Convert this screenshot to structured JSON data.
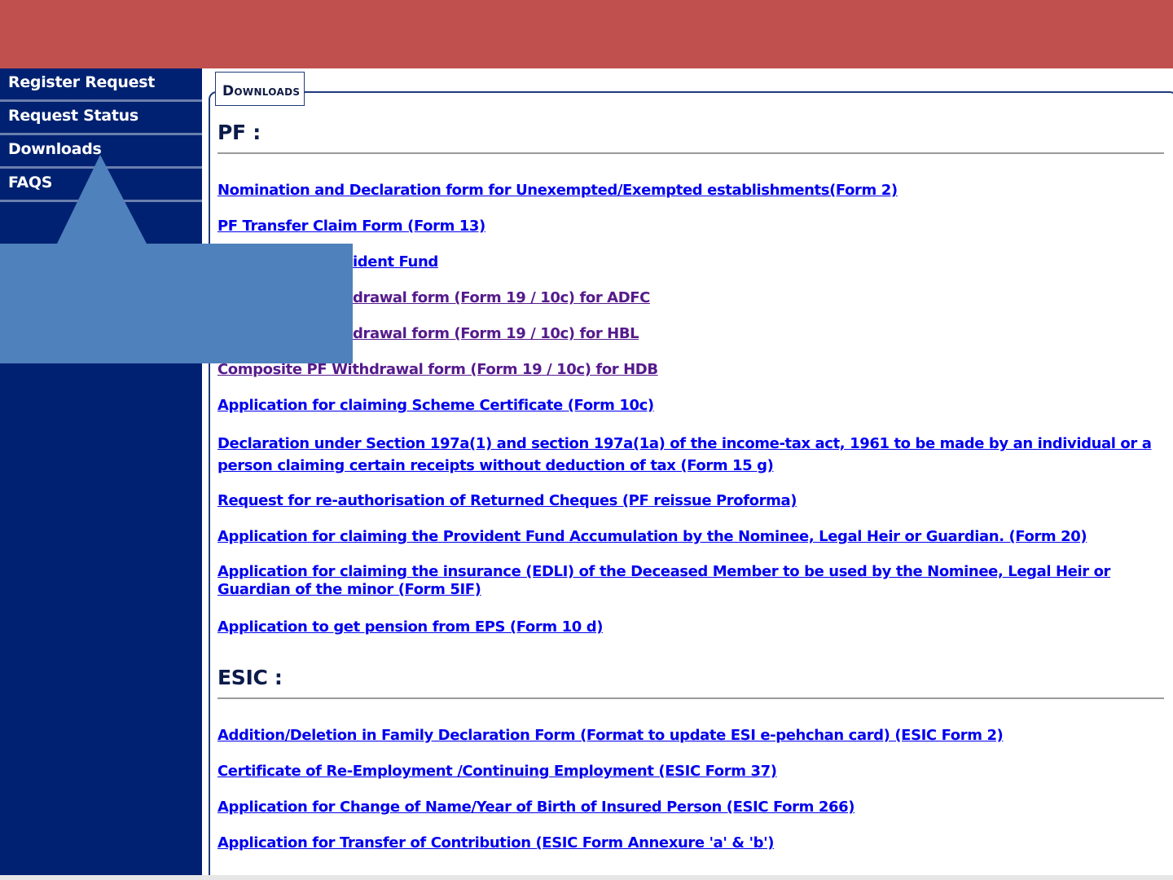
{
  "sidebar": {
    "items": [
      {
        "label": "Register Request"
      },
      {
        "label": "Request Status"
      },
      {
        "label": "Downloads"
      },
      {
        "label": "FAQS"
      }
    ]
  },
  "panel": {
    "legend": "Downloads",
    "pf_heading": "PF :",
    "esic_heading": "ESIC :"
  },
  "pf_links": [
    {
      "text": "Nomination and Declaration form for Unexempted/Exempted establishments(Form 2)"
    },
    {
      "text": "PF Transfer Claim Form (Form 13)"
    },
    {
      "text": "ident Fund"
    },
    {
      "text": "drawal form (Form 19 / 10c) for ADFC"
    },
    {
      "text": "drawal form (Form 19 / 10c) for HBL"
    },
    {
      "text": "Composite PF Withdrawal form (Form 19 / 10c) for HDB"
    },
    {
      "text": "Application for claiming Scheme Certificate (Form 10c)"
    },
    {
      "text": "Declaration under Section 197a(1) and section 197a(1a) of the income-tax act, 1961 to be made by an individual or a person claiming certain receipts without deduction of tax (Form 15 g)"
    },
    {
      "text": "Request for re-authorisation of Returned Cheques (PF reissue Proforma)"
    },
    {
      "text": "Application for claiming the Provident Fund Accumulation by the Nominee, Legal Heir or Guardian. (Form 20)"
    },
    {
      "text": "Application for claiming the insurance (EDLI) of the Deceased Member to be used by the Nominee, Legal Heir or Guardian of the minor (Form 5IF)"
    },
    {
      "text": "Application to get pension from EPS (Form 10 d)"
    }
  ],
  "esic_links": [
    {
      "text": "Addition/Deletion in Family Declaration Form (Format to update ESI e-pehchan card) (ESIC Form 2)"
    },
    {
      "text": "Certificate of Re-Employment /Continuing Employment (ESIC Form 37)"
    },
    {
      "text": "Application for Change of Name/Year of Birth of Insured Person (ESIC Form 266)"
    },
    {
      "text": "Application for Transfer of Contribution (ESIC Form Annexure 'a' & 'b')"
    }
  ],
  "colors": {
    "topbar": "#c0504d",
    "sidebar": "#002171",
    "callout": "#4f81bd",
    "link": "#0000ee",
    "visited_link": "#551a8b"
  }
}
